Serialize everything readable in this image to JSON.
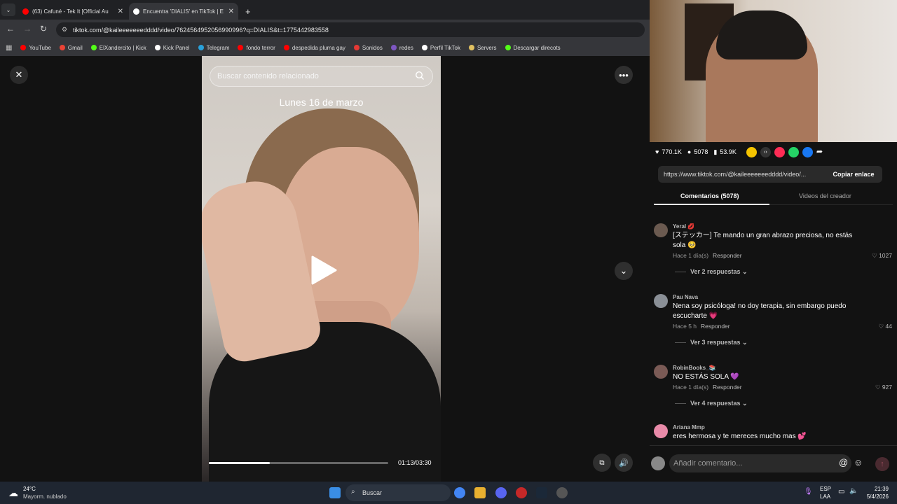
{
  "browser": {
    "tabs": [
      {
        "title": "(63) Cafuné - Tek It [Official Au",
        "favicon_color": "#ff0000"
      },
      {
        "title": "Encuentra 'DIALIS' en TikTok | E",
        "favicon_color": "#ffffff"
      }
    ],
    "new_tab_label": "+",
    "url": "tiktok.com/@kaileeeeeeedddd/video/7624564952056990996?q=DIALIS&t=1775442983558",
    "bookmarks": [
      {
        "label": "YouTube",
        "color": "#ff0000"
      },
      {
        "label": "Gmail",
        "color": "#ea4335"
      },
      {
        "label": "ElXandercito | Kick",
        "color": "#53fc18"
      },
      {
        "label": "Kick Panel",
        "color": "#ffffff"
      },
      {
        "label": "Telegram",
        "color": "#2aa1da"
      },
      {
        "label": "fondo terror",
        "color": "#ff0000"
      },
      {
        "label": "despedida pluma gay",
        "color": "#ff0000"
      },
      {
        "label": "Sonidos",
        "color": "#e53935"
      },
      {
        "label": "redes",
        "color": "#7e57c2"
      },
      {
        "label": "Perfil TikTok",
        "color": "#ffffff"
      },
      {
        "label": "Servers",
        "color": "#e0c060"
      },
      {
        "label": "Descargar direcots",
        "color": "#53fc18"
      }
    ]
  },
  "video": {
    "search_placeholder": "Buscar contenido relacionado",
    "overlay_text": "Lunes 16 de marzo",
    "time": "01:13/03:30",
    "progress": 0.34
  },
  "stats": {
    "likes": "770.1K",
    "comments": "5078",
    "saves": "53.9K"
  },
  "link": {
    "url": "https://www.tiktok.com/@kaileeeeeeedddd/video/...",
    "copy_label": "Copiar enlace"
  },
  "panel_tabs": {
    "comments": "Comentarios (5078)",
    "creator": "Videos del creador"
  },
  "comments": [
    {
      "user": "Yeral 💋",
      "text": "[ステッカー] Te mando un gran abrazo preciosa, no estás sola 🥺",
      "time": "Hace 1 día(s)",
      "reply": "Responder",
      "likes": "1027",
      "replies": "Ver 2 respuestas ⌄",
      "avatar_color": "#6b5a50"
    },
    {
      "user": "Pau Nava",
      "text": "Nena soy psicóloga! no doy terapia, sin embargo puedo escucharte 💗",
      "time": "Hace 5 h",
      "reply": "Responder",
      "likes": "44",
      "replies": "Ver 3 respuestas ⌄",
      "avatar_color": "#8a8f96"
    },
    {
      "user": "RobinBooks_📚",
      "text": "NO ESTÁS SOLA 💜",
      "time": "Hace 1 día(s)",
      "reply": "Responder",
      "likes": "927",
      "replies": "Ver 4 respuestas ⌄",
      "avatar_color": "#7a5a55"
    },
    {
      "user": "Ariana Mmp",
      "text": "eres hermosa y te mereces mucho mas 💕",
      "time": "",
      "reply": "",
      "likes": "",
      "replies": "",
      "avatar_color": "#e88aa8"
    }
  ],
  "comment_input_placeholder": "Añadir comentario...",
  "taskbar": {
    "weather_temp": "24°C",
    "weather_desc": "Mayorm. nublado",
    "search": "Buscar",
    "lang1": "ESP",
    "lang2": "LAA",
    "time": "21:39",
    "date": "5/4/2026"
  }
}
